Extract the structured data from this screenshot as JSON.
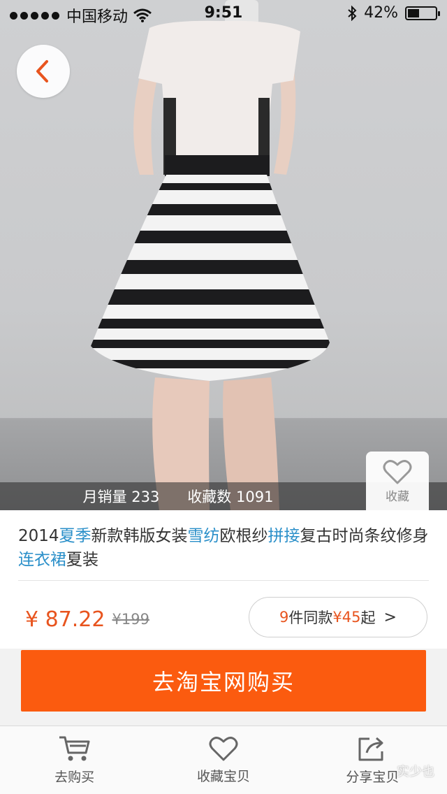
{
  "status_bar": {
    "carrier": "中国移动",
    "time": "9:51",
    "battery_pct": "42%",
    "battery_level": 0.42
  },
  "stats": {
    "monthly_sales": "月销量 233",
    "favorites": "收藏数 1091"
  },
  "favorite_button": {
    "label": "收藏"
  },
  "product": {
    "title_parts": [
      {
        "text": "2014",
        "hl": false
      },
      {
        "text": "夏季",
        "hl": true
      },
      {
        "text": "新款韩版女装",
        "hl": false
      },
      {
        "text": "雪纺",
        "hl": true
      },
      {
        "text": "欧根纱",
        "hl": false
      },
      {
        "text": "拼接",
        "hl": true
      },
      {
        "text": "复古时尚条纹修身",
        "hl": false
      },
      {
        "text": "连衣裙",
        "hl": true
      },
      {
        "text": "夏装",
        "hl": false
      }
    ],
    "price": "¥ 87.22",
    "original_price": "¥199"
  },
  "same_items": {
    "count": "9",
    "text_mid": "件同款",
    "from_price": "¥45",
    "text_end": "起",
    "chevron": ">"
  },
  "buy_button": {
    "label": "去淘宝网购买"
  },
  "tabs": [
    {
      "label": "去购买",
      "icon": "cart-icon"
    },
    {
      "label": "收藏宝贝",
      "icon": "heart-icon"
    },
    {
      "label": "分享宝贝",
      "icon": "share-icon"
    }
  ],
  "watermark": "实少也",
  "colors": {
    "accent": "#fb5b0f",
    "price": "#e8541e",
    "highlight": "#2a8fc9"
  }
}
